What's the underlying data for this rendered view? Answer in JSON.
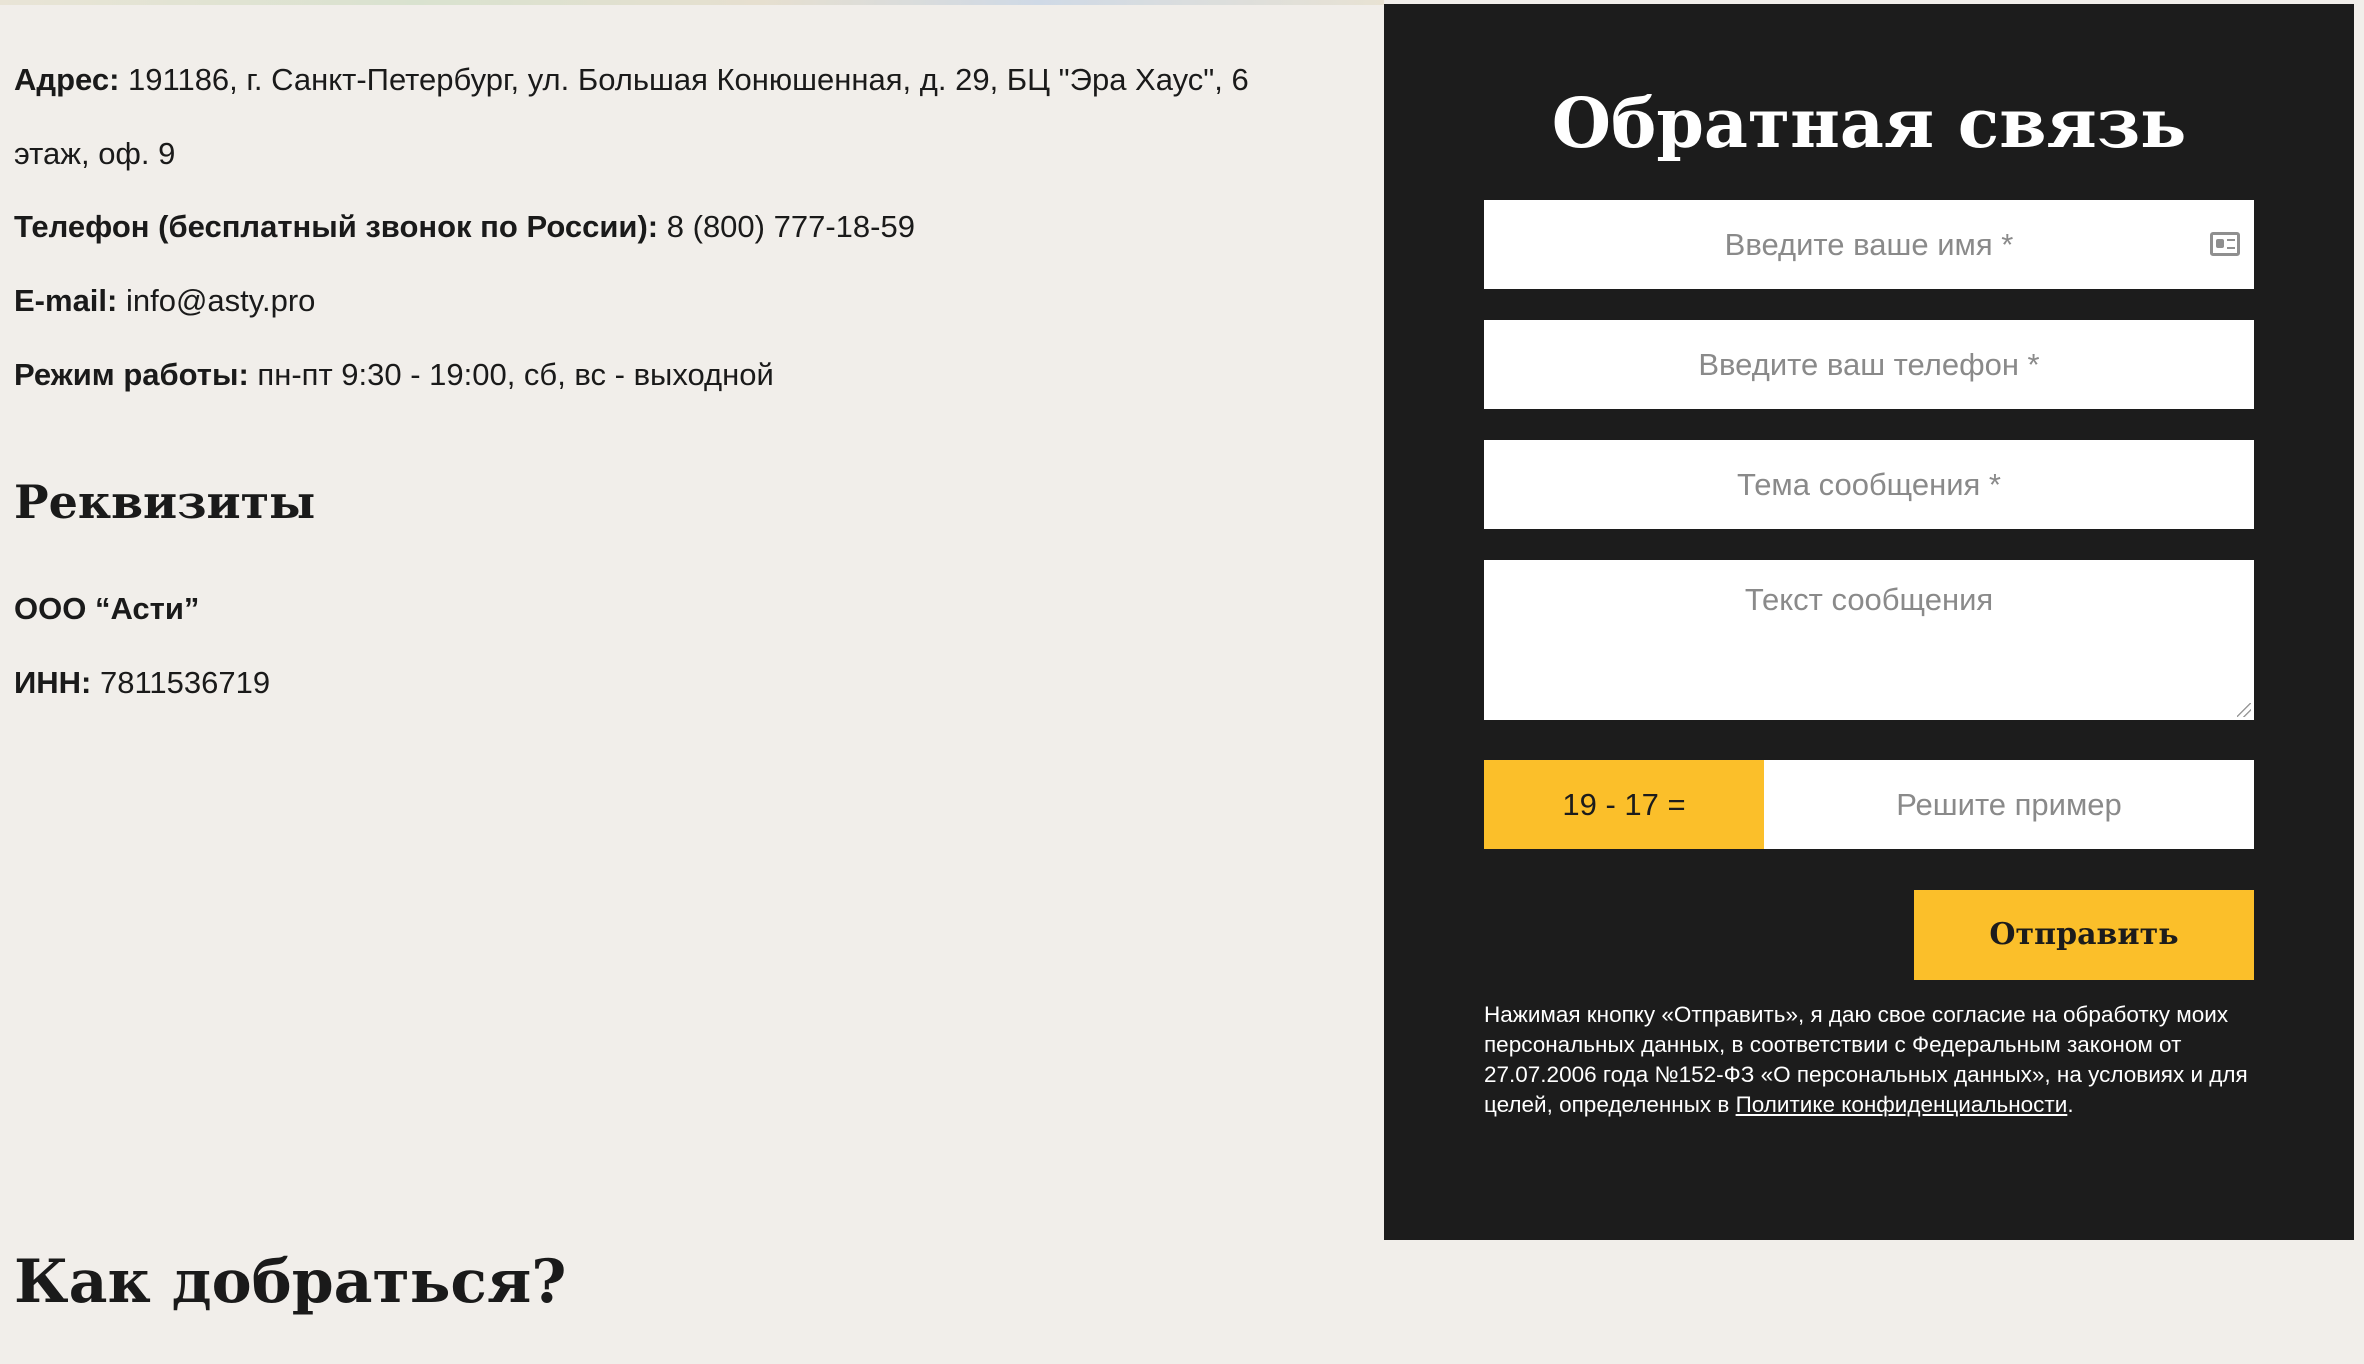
{
  "contacts": {
    "address_label": "Адрес:",
    "address_value": "191186, г. Санкт-Петербург, ул. Большая Конюшенная, д. 29, БЦ \"Эра Хаус\", 6",
    "address_cont": "этаж, оф. 9",
    "phone_label": "Телефон (бесплатный звонок по России):",
    "phone_value": "8 (800) 777-18-59",
    "email_label": "E-mail:",
    "email_value": "info@asty.pro",
    "hours_label": "Режим работы:",
    "hours_value": "пн-пт 9:30 - 19:00, сб, вс - выходной"
  },
  "requisites": {
    "heading": "Реквизиты",
    "company": "ООО “Асти”",
    "inn_label": "ИНН:",
    "inn_value": "7811536719"
  },
  "directions": {
    "heading": "Как добраться?"
  },
  "feedback_form": {
    "title": "Обратная связь",
    "name_placeholder": "Введите ваше имя *",
    "phone_placeholder": "Введите ваш телефон *",
    "subject_placeholder": "Тема сообщения *",
    "message_placeholder": "Текст сообщения",
    "captcha_question": "19 - 17 =",
    "captcha_placeholder": "Решите пример",
    "submit_label": "Отправить",
    "consent_text": "Нажимая кнопку «Отправить», я даю свое согласие на обработку моих персональных данных, в соответствии с Федеральным законом от 27.07.2006 года №152-ФЗ «О персональных данных», на условиях и для целей, определенных в ",
    "consent_link": "Политике конфиденциальности",
    "consent_end": "."
  },
  "colors": {
    "page_bg": "#f1eeea",
    "panel_bg": "#1c1c1c",
    "accent": "#fbbf2a"
  },
  "icons": {
    "name_field_icon": "contact-card-icon"
  }
}
